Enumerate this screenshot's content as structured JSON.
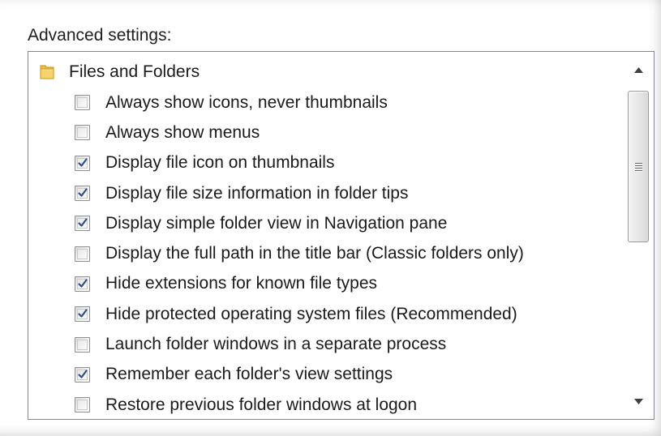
{
  "section_label": "Advanced settings:",
  "group": {
    "label": "Files and Folders",
    "icon": "folder-icon"
  },
  "items": [
    {
      "label": "Always show icons, never thumbnails",
      "checked": false
    },
    {
      "label": "Always show menus",
      "checked": false
    },
    {
      "label": "Display file icon on thumbnails",
      "checked": true
    },
    {
      "label": "Display file size information in folder tips",
      "checked": true
    },
    {
      "label": "Display simple folder view in Navigation pane",
      "checked": true
    },
    {
      "label": "Display the full path in the title bar (Classic folders only)",
      "checked": false
    },
    {
      "label": "Hide extensions for known file types",
      "checked": true
    },
    {
      "label": "Hide protected operating system files (Recommended)",
      "checked": true
    },
    {
      "label": "Launch folder windows in a separate process",
      "checked": false
    },
    {
      "label": "Remember each folder's view settings",
      "checked": true
    },
    {
      "label": "Restore previous folder windows at logon",
      "checked": false
    }
  ],
  "scrollbar": {
    "up_icon": "triangle-up-icon",
    "down_icon": "triangle-down-icon"
  },
  "colors": {
    "check_mark": "#2d4f8f",
    "folder_yellow": "#f2c13c",
    "border": "#828790"
  }
}
